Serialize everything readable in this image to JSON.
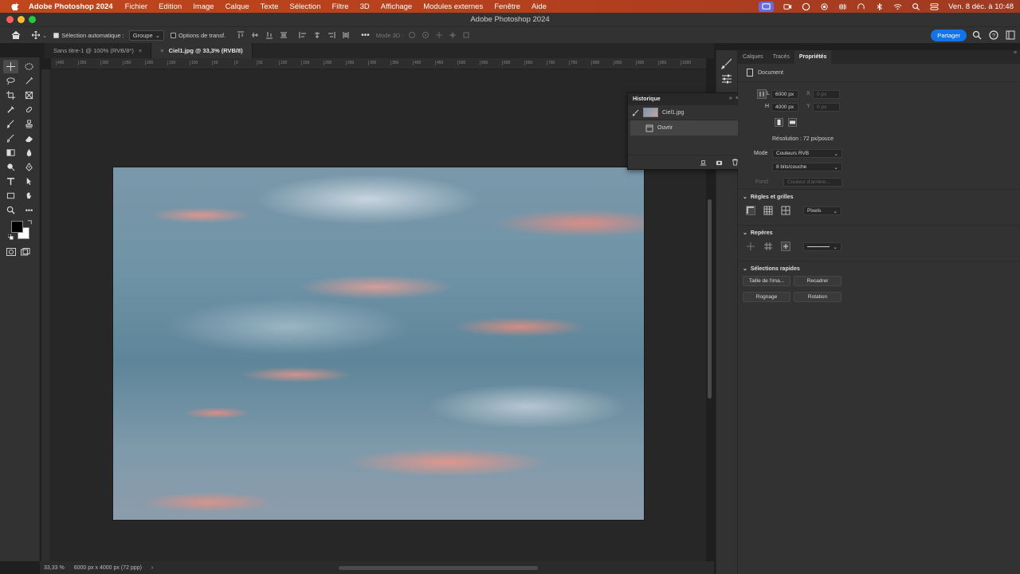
{
  "menubar": {
    "app_name": "Adobe Photoshop 2024",
    "items": [
      "Fichier",
      "Edition",
      "Image",
      "Calque",
      "Texte",
      "Sélection",
      "Filtre",
      "3D",
      "Affichage",
      "Modules externes",
      "Fenêtre",
      "Aide"
    ],
    "datetime": "Ven. 8 déc. à 10:48"
  },
  "window": {
    "title": "Adobe Photoshop 2024"
  },
  "options": {
    "auto_select_label": "Sélection automatique :",
    "auto_select_value": "Groupe",
    "transform_label": "Options de transf.",
    "mode3d_label": "Mode 3D :",
    "share_label": "Partager"
  },
  "tabs": [
    {
      "label": "Sans titre-1 @ 100% (RVB/8*)",
      "close": "×"
    },
    {
      "label": "Ciel1.jpg @ 33,3% (RVB/8)",
      "close": "×"
    }
  ],
  "ruler_ticks": [
    "400",
    "350",
    "300",
    "250",
    "200",
    "150",
    "100",
    "50",
    "0",
    "50",
    "100",
    "150",
    "200",
    "250",
    "300",
    "350",
    "400",
    "450",
    "500",
    "550",
    "600",
    "650",
    "700",
    "750",
    "800",
    "850",
    "900",
    "950",
    "1000"
  ],
  "statusbar": {
    "zoom": "33,33 %",
    "doc_info": "6000 px x 4000 px (72 ppp)",
    "arrow": "›"
  },
  "history": {
    "title": "Historique",
    "snapshot": "Ciel1.jpg",
    "step": "Ouvrir"
  },
  "properties": {
    "tabs": [
      "Calques",
      "Tracés",
      "Propriétés"
    ],
    "doc_label": "Document",
    "w_label": "L",
    "w_value": "6000 px",
    "h_label": "H",
    "h_value": "4000 px",
    "x_label": "X",
    "x_value": "0 px",
    "y_label": "Y",
    "y_value": "0 px",
    "resolution": "Résolution : 72 px/pouce",
    "mode_label": "Mode",
    "mode_value": "Couleurs RVB",
    "depth_value": "8 bits/couche",
    "bg_label": "Fond",
    "bg_value": "Couleur d'arrière...",
    "rulers_title": "Règles et grilles",
    "units_value": "Pixels",
    "guides_title": "Repères",
    "quick_title": "Sélections rapides",
    "btn_image_size": "Taille de l'ima...",
    "btn_recenter": "Recadrer",
    "btn_crop": "Rognage",
    "btn_rotate": "Rotation"
  },
  "colors": {
    "accent": "#1473e6",
    "menubar": "#b5401d",
    "panel": "#323232"
  }
}
